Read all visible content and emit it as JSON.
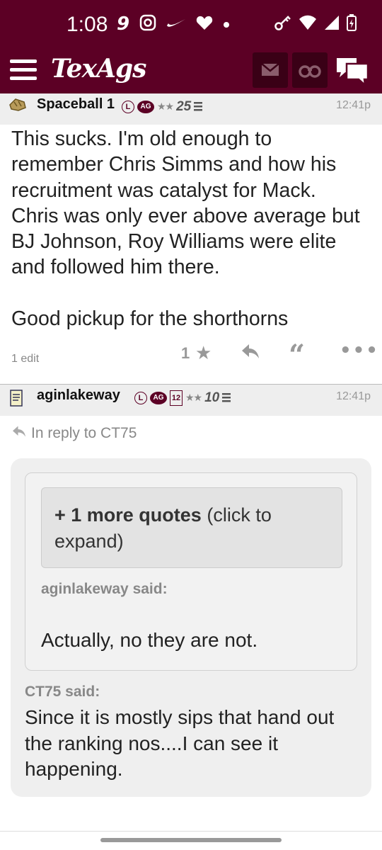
{
  "status_bar": {
    "time": "1:08",
    "left_icons": [
      "nine-icon",
      "instagram-icon",
      "nike-icon",
      "heart-icon",
      "dot-icon"
    ],
    "right_icons": [
      "key-icon",
      "wifi-icon",
      "signal-icon",
      "battery-icon"
    ]
  },
  "app_bar": {
    "logo": "TexAgs",
    "buttons": [
      "menu-icon",
      "mail-icon",
      "binoculars-icon",
      "chat-icon"
    ]
  },
  "colors": {
    "brand": "#5c0025",
    "header_bg": "#eeeeee",
    "quote_bg": "#efefef"
  },
  "posts": [
    {
      "author": "Spaceball 1",
      "badges": [
        "L",
        "AG"
      ],
      "stars": "★★",
      "rank": "25",
      "time": "12:41p",
      "body": "This sucks. I'm old enough to\nremember Chris Simms and how his\nrecruitment was catalyst for Mack.\nChris was only ever above average but\nBJ Johnson, Roy Williams were elite\nand followed him there.\n\nGood pickup for the shorthorns",
      "edit_note": "1 edit",
      "like_count": "1"
    },
    {
      "author": "aginlakeway",
      "badges": [
        "L",
        "AG",
        "12"
      ],
      "stars": "★★",
      "rank": "10",
      "time": "12:41p",
      "in_reply_to": "In reply to CT75",
      "more_quotes_bold": "+ 1 more quotes",
      "more_quotes_rest": " (click to expand)",
      "inner_said": "aginlakeway said:",
      "inner_text": "Actually, no they are not.",
      "outer_said": "CT75 said:",
      "outer_text": "Since it is mostly sips that hand out the ranking nos....I can see it happening."
    }
  ]
}
